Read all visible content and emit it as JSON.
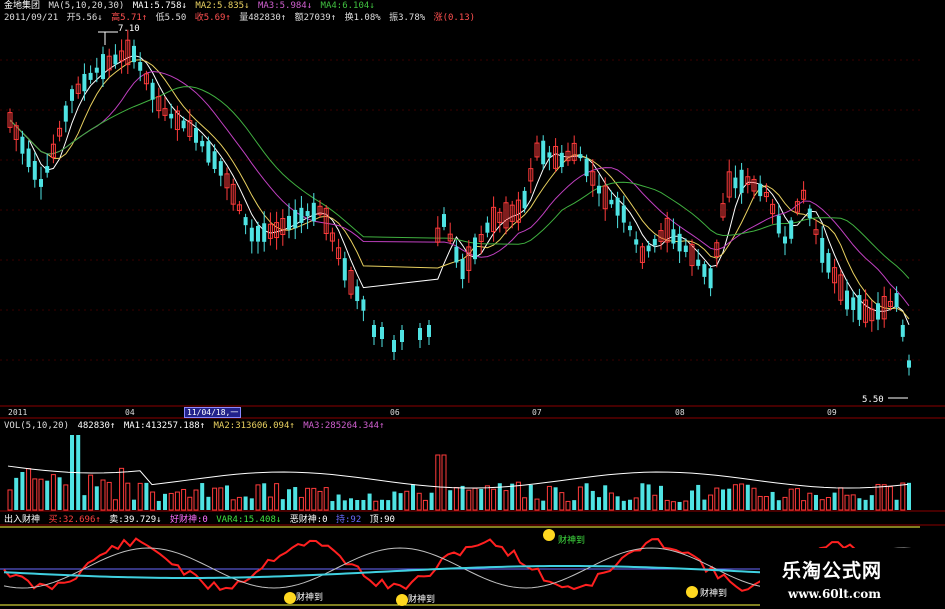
{
  "colors": {
    "up": "#ff3b3b",
    "down": "#4fe3e3",
    "ma1": "#ffffff",
    "ma2": "#e8d060",
    "ma3": "#c040c0",
    "ma4": "#40b040",
    "grid": "#8b0000",
    "yellow": "#ffff40",
    "white": "#ffffff",
    "blue": "#6a6aff"
  },
  "header": {
    "stock_name": "金地集团",
    "ma_label": "MA(5,10,20,30)",
    "ma1": "MA1:5.758↓",
    "ma2": "MA2:5.835↓",
    "ma3": "MA3:5.984↓",
    "ma4": "MA4:6.104↓",
    "date": "2011/09/21",
    "open": "开5.56↓",
    "high": "高5.71↑",
    "low": "低5.50",
    "close": "收5.69↑",
    "volume": "量482830↑",
    "amount": "额27039↑",
    "turnover": "换1.08%",
    "amplitude": "振3.78%",
    "change": "涨(0.13)"
  },
  "price_annotations": {
    "high_label": "7.10",
    "low_label": "5.50"
  },
  "date_axis": {
    "labels": [
      "2011",
      "04",
      "06",
      "07",
      "08",
      "09"
    ],
    "selected_date": "11/04/18,一"
  },
  "volume_header": {
    "vol_label": "VOL(5,10,20)",
    "vol": "482830↑",
    "ma1": "MA1:413257.188↑",
    "ma2": "MA2:313606.094↑",
    "ma3": "MA3:285264.344↑"
  },
  "indicator_header": {
    "name": "出入财神",
    "buy": "买:32.696↑",
    "sell": "卖:39.729↓",
    "good": "好财神:0",
    "var4": "VAR4:15.408↓",
    "bad": "恶财神:0",
    "hold": "持:92",
    "top": "顶:90"
  },
  "indicator_signals": [
    "财神到",
    "财神到",
    "财神到",
    "财神到"
  ],
  "brand": {
    "name": "乐淘公式网",
    "url": "www.60lt.com"
  }
}
